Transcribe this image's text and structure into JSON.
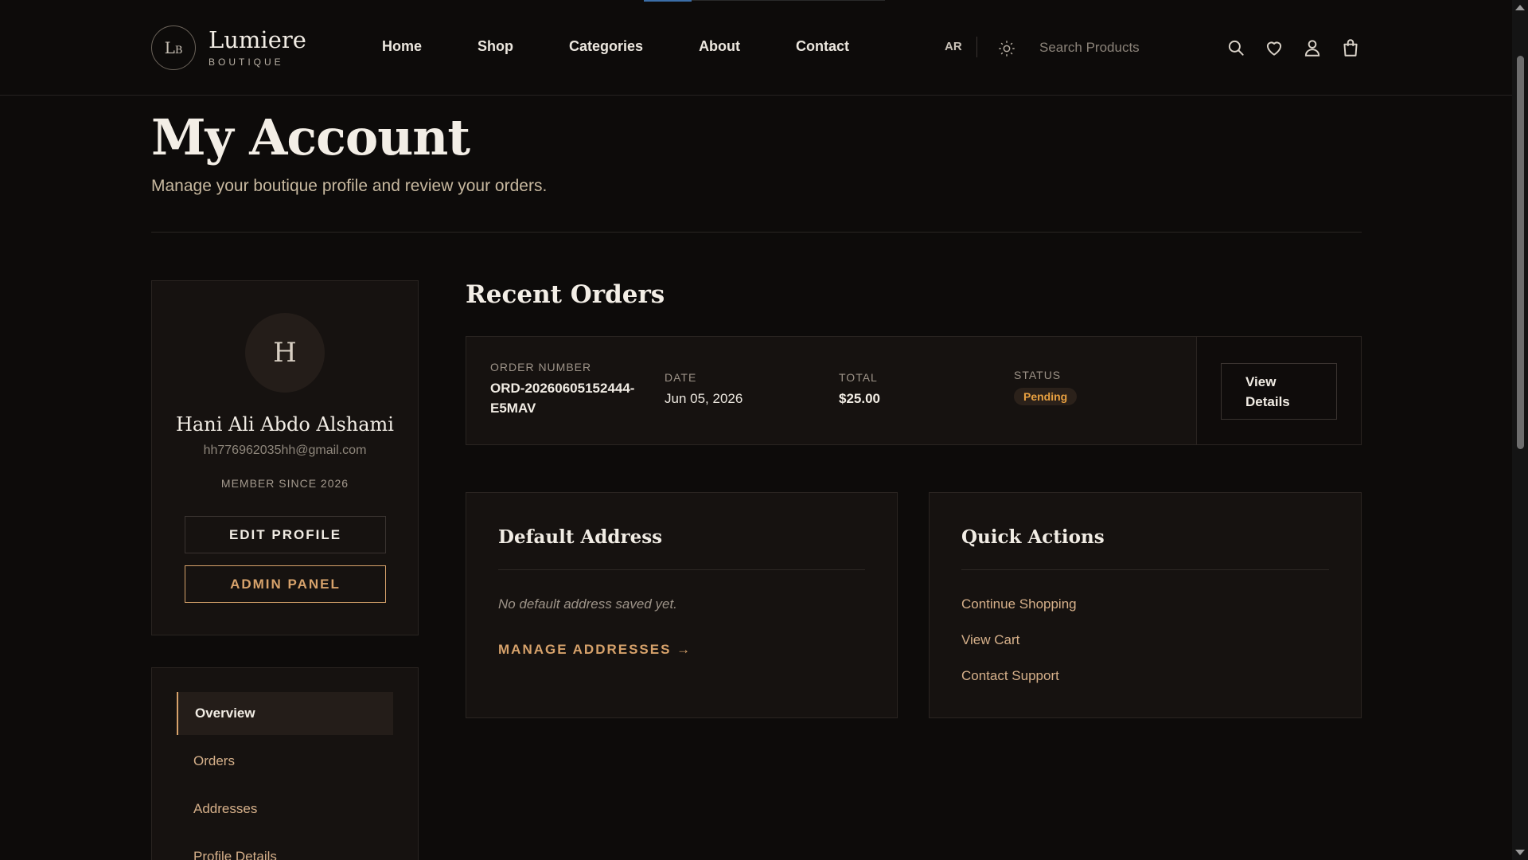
{
  "brand": {
    "monogram": "LB",
    "name": "Lumiere",
    "tagline": "BOUTIQUE"
  },
  "nav": {
    "items": [
      "Home",
      "Shop",
      "Categories",
      "About",
      "Contact"
    ]
  },
  "header": {
    "language": "AR",
    "search_placeholder": "Search Products",
    "icons": [
      "theme-toggle-icon",
      "search-icon",
      "heart-icon",
      "user-icon",
      "shopping-bag-icon"
    ]
  },
  "page": {
    "title": "My Account",
    "subtitle": "Manage your boutique profile and review your orders."
  },
  "profile": {
    "initial": "H",
    "name": "Hani Ali Abdo Alshami",
    "email": "hh776962035hh@gmail.com",
    "member_since": "MEMBER SINCE 2026",
    "edit_label": "EDIT PROFILE",
    "admin_label": "ADMIN PANEL"
  },
  "sidenav": {
    "items": [
      {
        "label": "Overview",
        "active": true
      },
      {
        "label": "Orders",
        "active": false
      },
      {
        "label": "Addresses",
        "active": false
      },
      {
        "label": "Profile Details",
        "active": false
      }
    ]
  },
  "orders": {
    "title": "Recent Orders",
    "list": [
      {
        "number_label": "ORDER NUMBER",
        "number": "ORD-20260605152444-E5MAV",
        "number_line1": "ORD-20260605152444-",
        "number_line2": "E5MAV",
        "date_label": "DATE",
        "date": "Jun 05, 2026",
        "total_label": "TOTAL",
        "total": "$25.00",
        "status_label": "STATUS",
        "status": "Pending",
        "action_line1": "View",
        "action_line2": "Details"
      }
    ]
  },
  "address": {
    "title": "Default Address",
    "empty_text": "No default address saved yet.",
    "link_label": "MANAGE ADDRESSES →"
  },
  "quick_actions": {
    "title": "Quick Actions",
    "links": [
      "Continue Shopping",
      "View Cart",
      "Contact Support"
    ]
  },
  "colors": {
    "background": "#0d0b0a",
    "card": "#161210",
    "accent": "#d7a26b",
    "status_pending": "#e8a040"
  }
}
